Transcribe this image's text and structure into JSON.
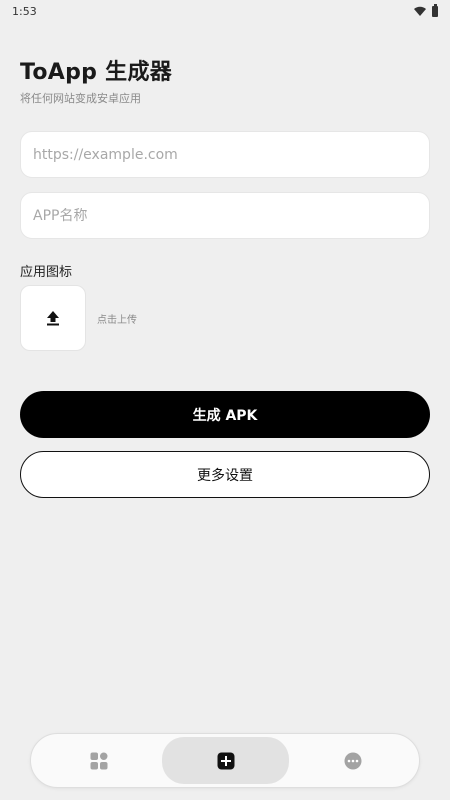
{
  "status_bar": {
    "time": "1:53"
  },
  "header": {
    "title": "ToApp 生成器",
    "subtitle": "将任何网站变成安卓应用"
  },
  "form": {
    "url_placeholder": "https://example.com",
    "name_placeholder": "APP名称",
    "icon_label": "应用图标",
    "upload_hint": "点击上传"
  },
  "buttons": {
    "generate_label": "生成 APK",
    "more_settings_label": "更多设置"
  },
  "bottom_nav": {
    "items": [
      {
        "icon": "apps-grid-icon",
        "active": false
      },
      {
        "icon": "add-square-icon",
        "active": true
      },
      {
        "icon": "more-circle-icon",
        "active": false
      }
    ]
  },
  "colors": {
    "background": "#efefef",
    "primary": "#000000",
    "muted_text": "#8a8a8a",
    "nav_active_bg": "#e2e2e2"
  }
}
